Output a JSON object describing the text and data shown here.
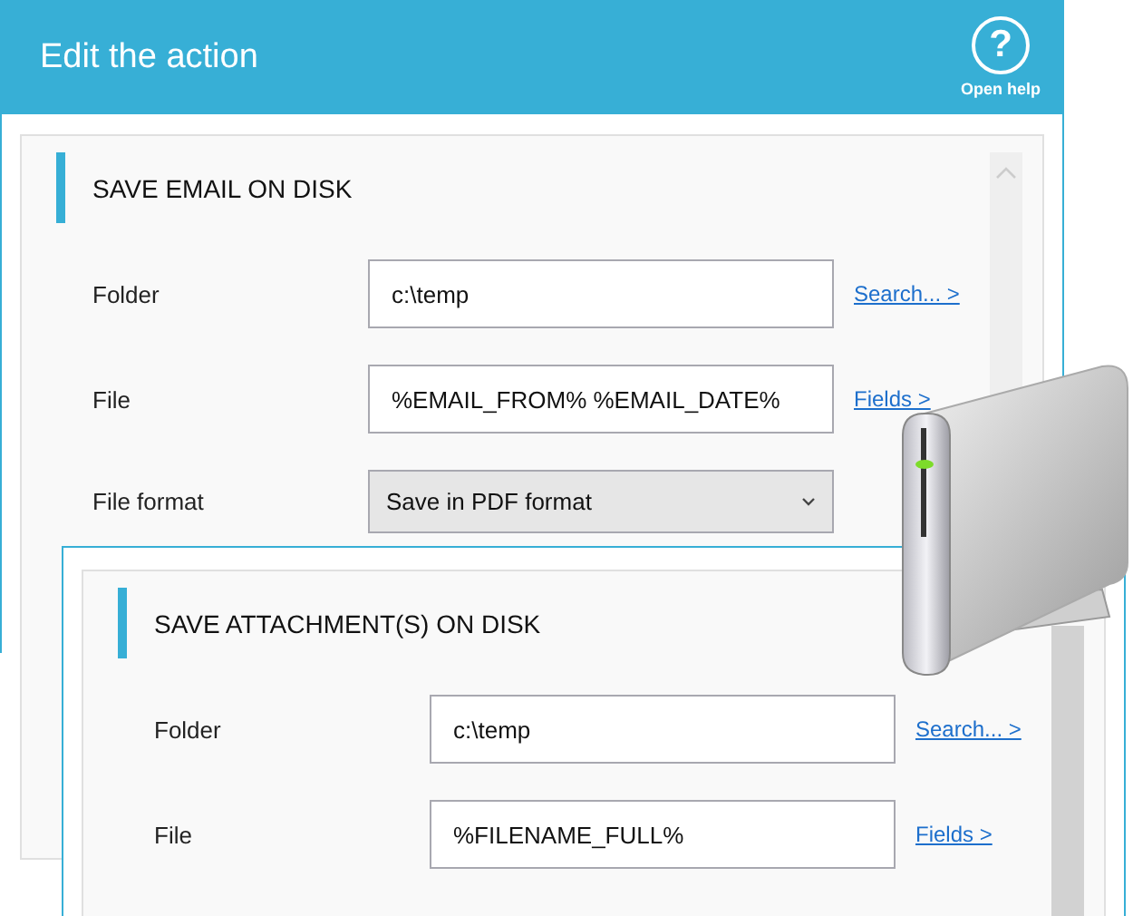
{
  "main_window": {
    "title": "Edit the action",
    "help_glyph": "?",
    "help_label": "Open help",
    "section": {
      "title": "SAVE EMAIL ON DISK",
      "rows": [
        {
          "kind": "text",
          "label": "Folder",
          "value": "c:\\temp",
          "link": "Search... >"
        },
        {
          "kind": "text",
          "label": "File",
          "value": "%EMAIL_FROM% %EMAIL_DATE%",
          "link": "Fields >"
        },
        {
          "kind": "select",
          "label": "File format",
          "value": "Save in PDF format"
        }
      ]
    }
  },
  "second_window": {
    "section": {
      "title": "SAVE ATTACHMENT(S) ON DISK",
      "rows": [
        {
          "kind": "text",
          "label": "Folder",
          "value": "c:\\temp",
          "link": "Search... >"
        },
        {
          "kind": "text",
          "label": "File",
          "value": "%FILENAME_FULL%",
          "link": "Fields >"
        }
      ]
    }
  }
}
